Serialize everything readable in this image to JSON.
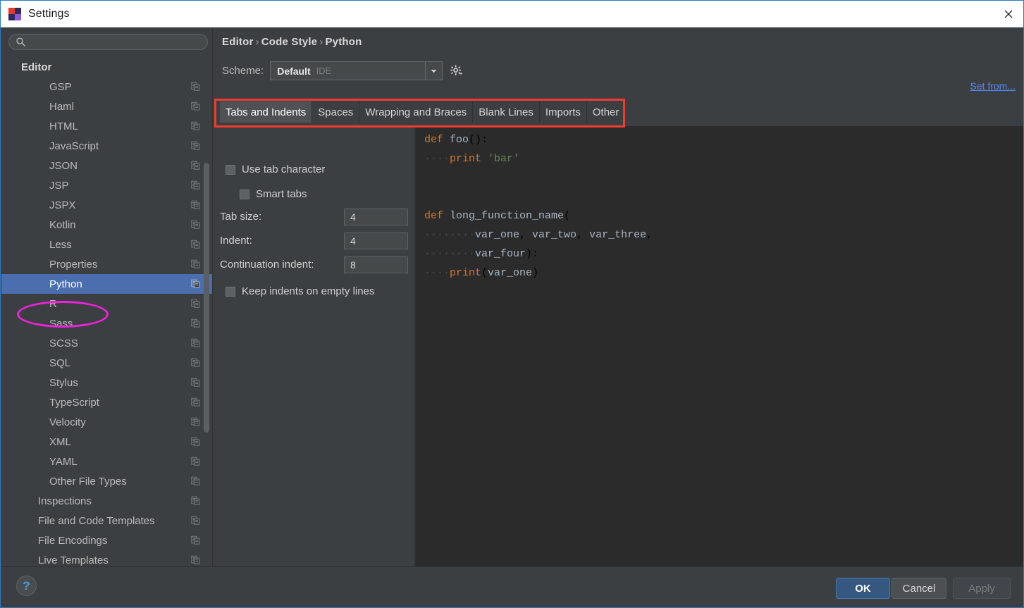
{
  "window": {
    "title": "Settings",
    "app_icon": "pycharm-icon",
    "close_icon": "close-icon"
  },
  "sidebar": {
    "search": {
      "value": "",
      "placeholder": "",
      "icon": "search-icon"
    },
    "tree": [
      {
        "label": "Editor",
        "level": 0,
        "selected": false,
        "icon": false
      },
      {
        "label": "GSP",
        "level": 2,
        "selected": false,
        "icon": true
      },
      {
        "label": "Haml",
        "level": 2,
        "selected": false,
        "icon": true
      },
      {
        "label": "HTML",
        "level": 2,
        "selected": false,
        "icon": true
      },
      {
        "label": "JavaScript",
        "level": 2,
        "selected": false,
        "icon": true
      },
      {
        "label": "JSON",
        "level": 2,
        "selected": false,
        "icon": true
      },
      {
        "label": "JSP",
        "level": 2,
        "selected": false,
        "icon": true
      },
      {
        "label": "JSPX",
        "level": 2,
        "selected": false,
        "icon": true
      },
      {
        "label": "Kotlin",
        "level": 2,
        "selected": false,
        "icon": true
      },
      {
        "label": "Less",
        "level": 2,
        "selected": false,
        "icon": true
      },
      {
        "label": "Properties",
        "level": 2,
        "selected": false,
        "icon": true
      },
      {
        "label": "Python",
        "level": 2,
        "selected": true,
        "icon": true
      },
      {
        "label": "R",
        "level": 2,
        "selected": false,
        "icon": true
      },
      {
        "label": "Sass",
        "level": 2,
        "selected": false,
        "icon": true
      },
      {
        "label": "SCSS",
        "level": 2,
        "selected": false,
        "icon": true
      },
      {
        "label": "SQL",
        "level": 2,
        "selected": false,
        "icon": true
      },
      {
        "label": "Stylus",
        "level": 2,
        "selected": false,
        "icon": true
      },
      {
        "label": "TypeScript",
        "level": 2,
        "selected": false,
        "icon": true
      },
      {
        "label": "Velocity",
        "level": 2,
        "selected": false,
        "icon": true
      },
      {
        "label": "XML",
        "level": 2,
        "selected": false,
        "icon": true
      },
      {
        "label": "YAML",
        "level": 2,
        "selected": false,
        "icon": true
      },
      {
        "label": "Other File Types",
        "level": 2,
        "selected": false,
        "icon": true
      },
      {
        "label": "Inspections",
        "level": 1,
        "selected": false,
        "icon": true
      },
      {
        "label": "File and Code Templates",
        "level": 1,
        "selected": false,
        "icon": true
      },
      {
        "label": "File Encodings",
        "level": 1,
        "selected": false,
        "icon": true
      },
      {
        "label": "Live Templates",
        "level": 1,
        "selected": false,
        "icon": true
      }
    ]
  },
  "main": {
    "breadcrumb": {
      "part1": "Editor",
      "part2": "Code Style",
      "part3": "Python",
      "separator": "›"
    },
    "scheme": {
      "label": "Scheme:",
      "value": "Default",
      "sub": "IDE",
      "arrow_icon": "chevron-down-icon",
      "gear_icon": "gear-icon"
    },
    "set_from_link": "Set from...",
    "tabs": [
      {
        "label": "Tabs and Indents",
        "active": true
      },
      {
        "label": "Spaces",
        "active": false
      },
      {
        "label": "Wrapping and Braces",
        "active": false
      },
      {
        "label": "Blank Lines",
        "active": false
      },
      {
        "label": "Imports",
        "active": false
      },
      {
        "label": "Other",
        "active": false
      }
    ],
    "options": {
      "use_tab_character": {
        "label": "Use tab character",
        "checked": false
      },
      "smart_tabs": {
        "label": "Smart tabs",
        "checked": false
      },
      "tab_size": {
        "label": "Tab size:",
        "value": "4"
      },
      "indent": {
        "label": "Indent:",
        "value": "4"
      },
      "continuation_indent": {
        "label": "Continuation indent:",
        "value": "8"
      },
      "keep_indents_on_empty_lines": {
        "label": "Keep indents on empty lines",
        "checked": false
      }
    },
    "preview_code": {
      "lines": [
        "def foo():",
        "    print 'bar'",
        "",
        "",
        "def long_function_name(",
        "        var_one, var_two, var_three,",
        "        var_four):",
        "    print(var_one)"
      ]
    }
  },
  "footer": {
    "help_icon": "help-question-icon",
    "ok": "OK",
    "cancel": "Cancel",
    "apply": "Apply"
  },
  "annotations": {
    "tabs_rect_color": "#f23a2e",
    "python_ellipse_color": "#ee22dd"
  }
}
